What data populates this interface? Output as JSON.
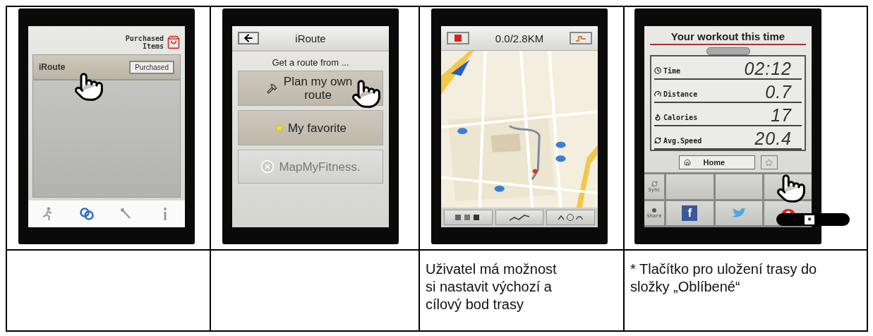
{
  "columns": [
    {
      "screen": {
        "kind": "store",
        "header": "Purchased Items",
        "item": {
          "name": "iRoute",
          "button": "Purchased"
        },
        "tabs": [
          {
            "selected": false
          },
          {
            "selected": true
          },
          {
            "selected": false
          },
          {
            "selected": false
          }
        ]
      }
    },
    {
      "screen": {
        "kind": "route_menu",
        "title": "iRoute",
        "subtitle": "Get a route from ...",
        "options": [
          {
            "label": "Plan my own route",
            "disabled": false
          },
          {
            "label": "My favorite",
            "disabled": false
          },
          {
            "label": "MapMyFitness.",
            "disabled": true
          }
        ]
      }
    },
    {
      "screen": {
        "kind": "map",
        "readout": "0.0/2.8KM"
      },
      "caption": "Uživatel má možnost si nastavit výchozí a cílový bod trasy"
    },
    {
      "screen": {
        "kind": "summary",
        "title": "Your workout this time",
        "stats": [
          {
            "label": "Time",
            "value": "02:12"
          },
          {
            "label": "Distance",
            "value": "0.7"
          },
          {
            "label": "Calories",
            "value": "17"
          },
          {
            "label": "Avg.Speed",
            "value": "20.4"
          }
        ],
        "home": "Home",
        "sync": "Sync",
        "share": "Share",
        "facebook": "f",
        "marker": "*"
      },
      "caption": "* Tlačítko pro uložení trasy do složky „Oblíbené“"
    }
  ]
}
